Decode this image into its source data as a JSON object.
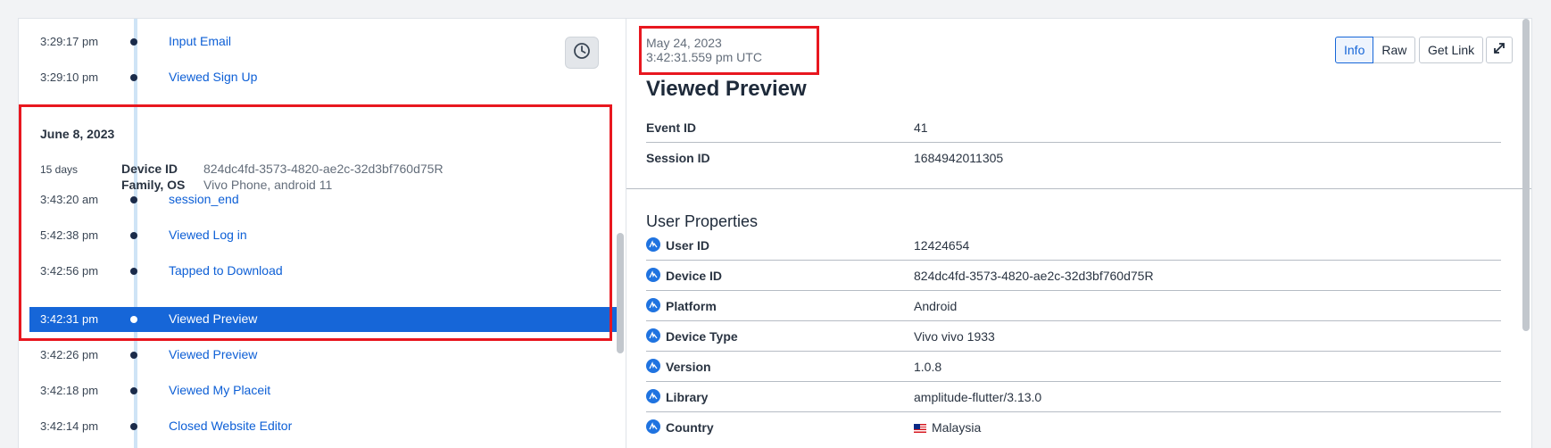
{
  "timeline": {
    "top_events": [
      {
        "time": "3:29:17 pm",
        "name": "Input Email"
      },
      {
        "time": "3:29:10 pm",
        "name": "Viewed Sign Up"
      }
    ],
    "day": {
      "date": "June 8, 2023",
      "session_age": "15 days",
      "device_id_label": "Device ID",
      "device_id_value": "824dc4fd-3573-4820-ae2c-32d3bf760d75R",
      "family_os_label": "Family, OS",
      "family_os_value": "Vivo Phone, android 11"
    },
    "events": [
      {
        "time": "3:43:20 am",
        "name": "session_end"
      },
      {
        "time": "5:42:38 pm",
        "name": "Viewed Log in"
      },
      {
        "time": "3:42:56 pm",
        "name": "Tapped to Download"
      },
      {
        "time": "3:42:31 pm",
        "name": "Viewed Preview",
        "selected": true
      },
      {
        "time": "3:42:26 pm",
        "name": "Viewed Preview"
      },
      {
        "time": "3:42:18 pm",
        "name": "Viewed My Placeit"
      },
      {
        "time": "3:42:14 pm",
        "name": "Closed Website Editor"
      }
    ],
    "clock_icon": "clock-icon"
  },
  "detail": {
    "date": "May 24, 2023",
    "time": "3:42:31.559 pm UTC",
    "title": "Viewed Preview",
    "buttons": {
      "info": "Info",
      "raw": "Raw",
      "get_link": "Get Link"
    },
    "expand_icon": "expand-icon",
    "event_fields": [
      {
        "label": "Event ID",
        "value": "41"
      },
      {
        "label": "Session ID",
        "value": "1684942011305"
      }
    ],
    "user_properties_title": "User Properties",
    "user_properties": [
      {
        "label": "User ID",
        "value": "12424654"
      },
      {
        "label": "Device ID",
        "value": "824dc4fd-3573-4820-ae2c-32d3bf760d75R"
      },
      {
        "label": "Platform",
        "value": "Android"
      },
      {
        "label": "Device Type",
        "value": "Vivo vivo 1933"
      },
      {
        "label": "Version",
        "value": "1.0.8"
      },
      {
        "label": "Library",
        "value": "amplitude-flutter/3.13.0"
      },
      {
        "label": "Country",
        "value": "Malaysia",
        "flag": "malaysia-flag"
      }
    ]
  },
  "colors": {
    "accent": "#1666d8",
    "highlight_box": "#e8171f",
    "link": "#0d5fd6"
  }
}
